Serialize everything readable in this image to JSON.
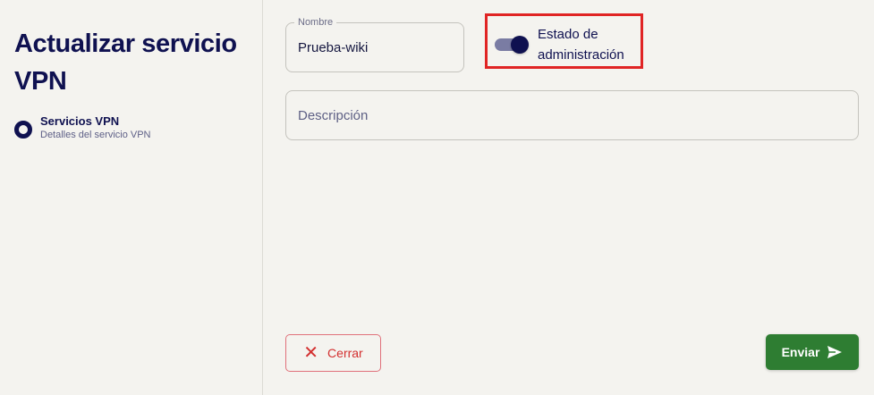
{
  "page": {
    "title": "Actualizar servicio VPN"
  },
  "stepper": {
    "steps": [
      {
        "title": "Servicios VPN",
        "subtitle": "Detalles del servicio VPN"
      }
    ]
  },
  "form": {
    "name": {
      "label": "Nombre",
      "value": "Prueba-wiki"
    },
    "admin_state": {
      "label": "Estado de administración",
      "enabled": true
    },
    "description": {
      "placeholder": "Descripción"
    }
  },
  "actions": {
    "close_label": "Cerrar",
    "send_label": "Enviar"
  },
  "colors": {
    "primary": "#0f1150",
    "success": "#2e7d32",
    "danger": "#d32f2f",
    "highlight": "#e02424"
  },
  "icons": {
    "close": "close-icon",
    "send": "send-icon"
  }
}
